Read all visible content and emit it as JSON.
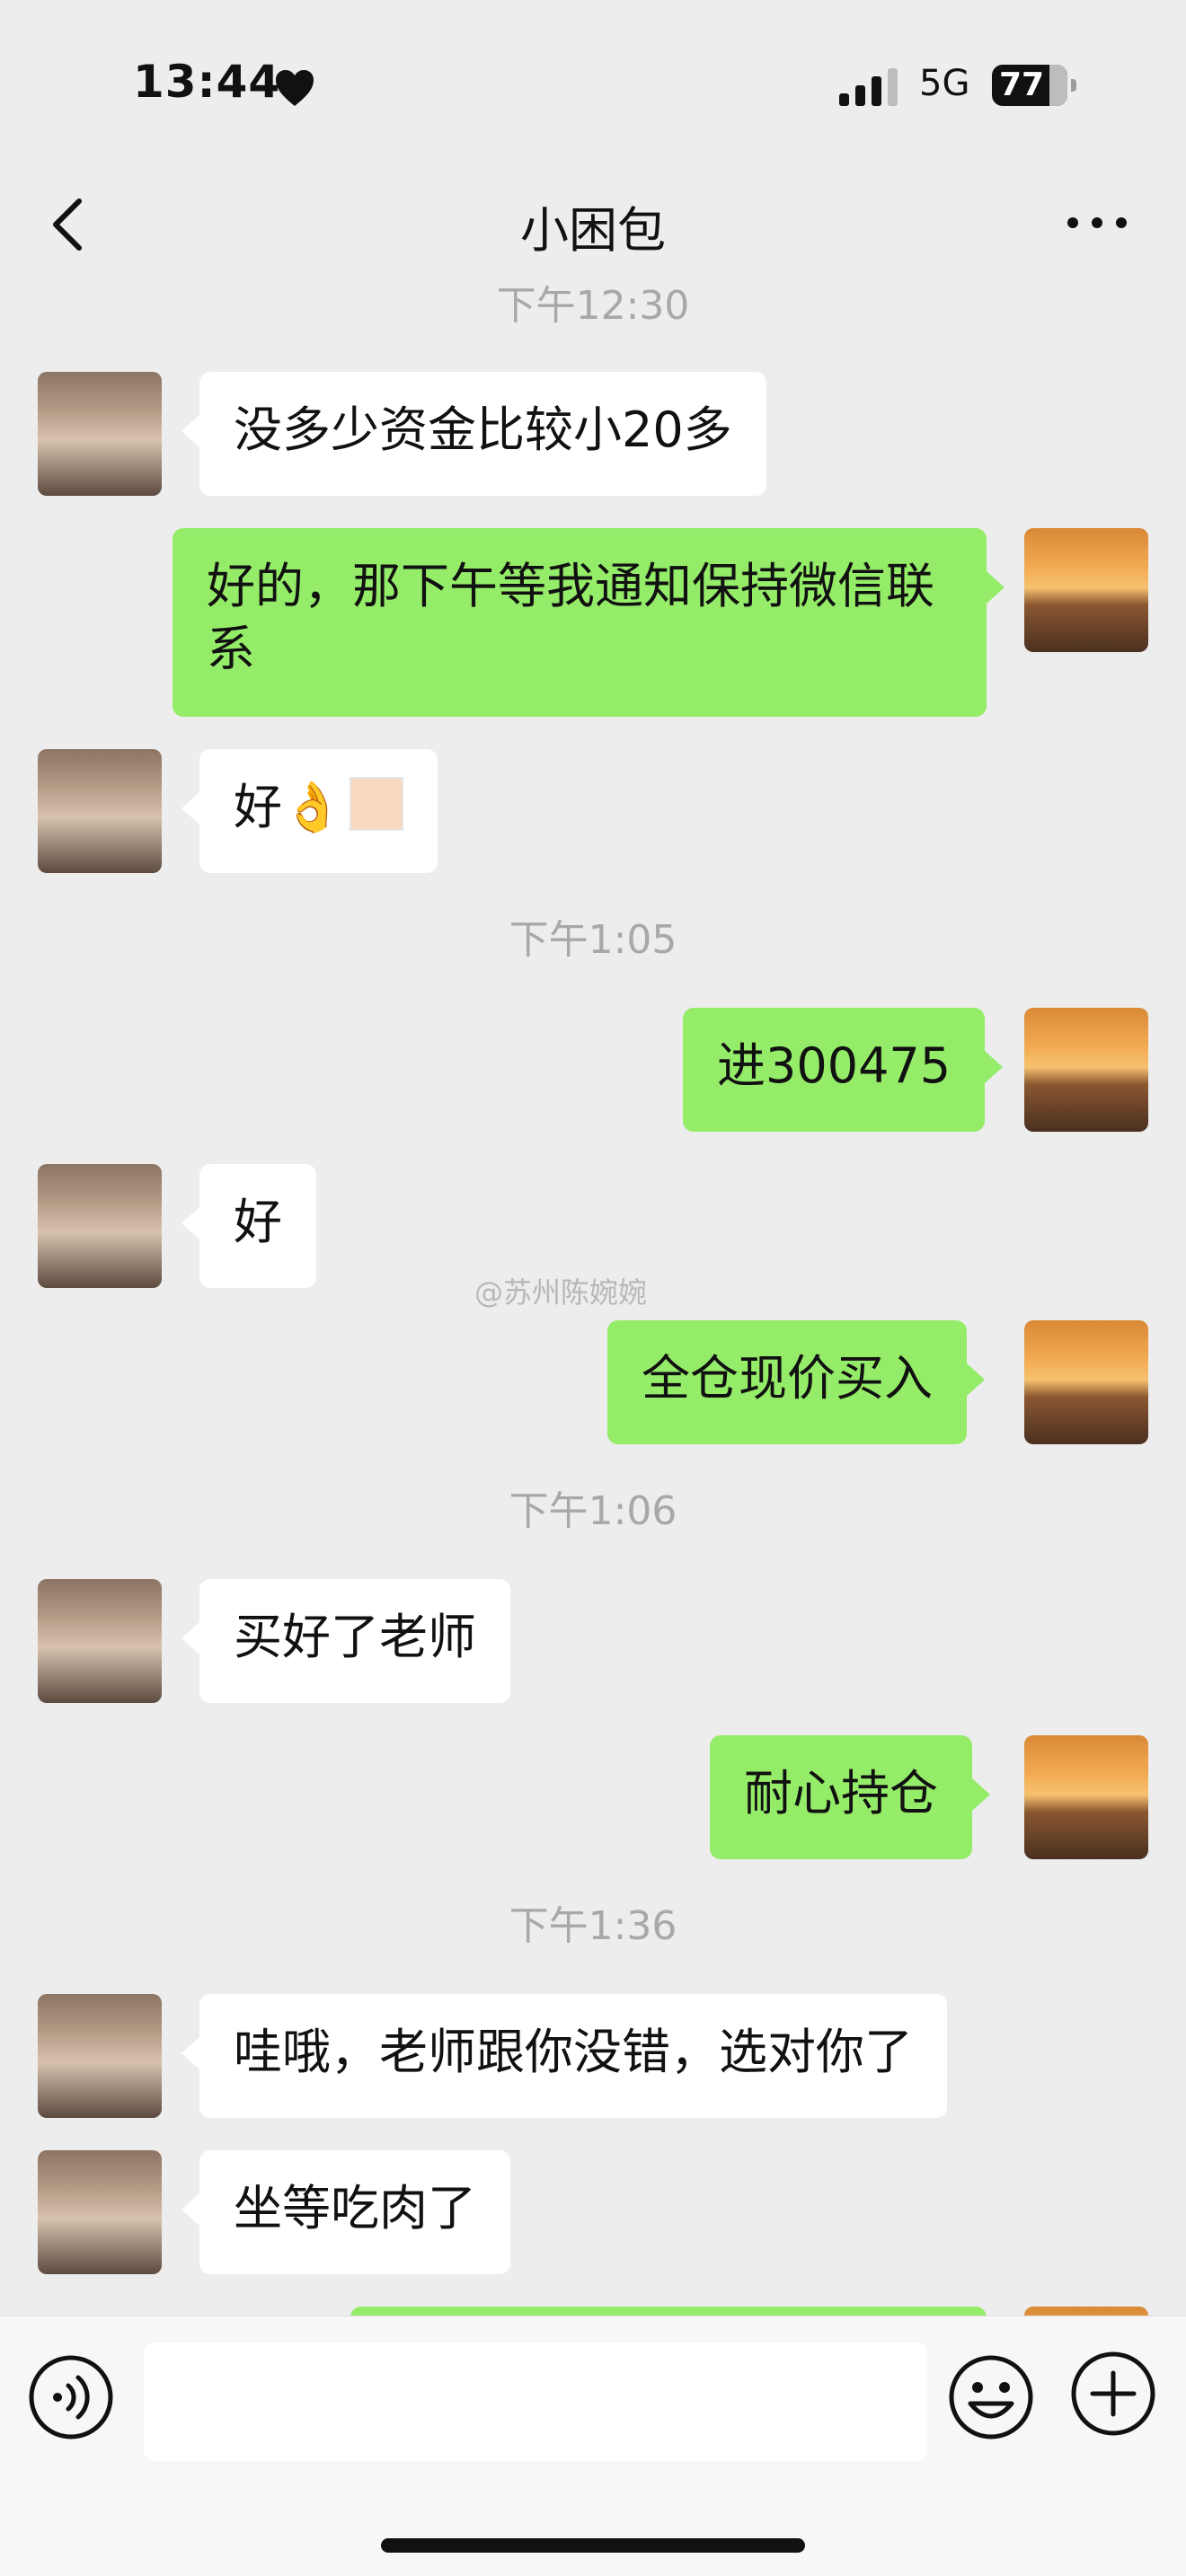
{
  "status_bar": {
    "time": "13:44",
    "network": "5G",
    "battery": "77"
  },
  "header": {
    "title": "小困包 "
  },
  "timestamps": {
    "t1": "下午12:30",
    "t2": "下午1:05",
    "t3": "下午1:06",
    "t4": "下午1:36"
  },
  "messages": {
    "m1": "没多少资金比较小20多",
    "m2": "好的，那下午等我通知保持微信联系",
    "m3": "好👌",
    "m4": "进300475",
    "m5": "好",
    "m6": "全仓现价买入",
    "m7": "买好了老师",
    "m8": "耐心持仓",
    "m9": "哇哦，老师跟你没错，选对你了",
    "m10": "坐等吃肉了"
  },
  "watermark": "@苏州陈婉婉",
  "colors": {
    "background": "#ededed",
    "bubble_self": "#95ec69",
    "bubble_other": "#ffffff",
    "timestamp": "#a8a8a8"
  },
  "icons": {
    "back": "chevron-left-icon",
    "more": "more-dots-icon",
    "voice": "voice-icon",
    "emoji": "emoji-icon",
    "plus": "plus-icon",
    "heart": "heart-icon",
    "signal": "signal-icon",
    "battery": "battery-icon"
  }
}
